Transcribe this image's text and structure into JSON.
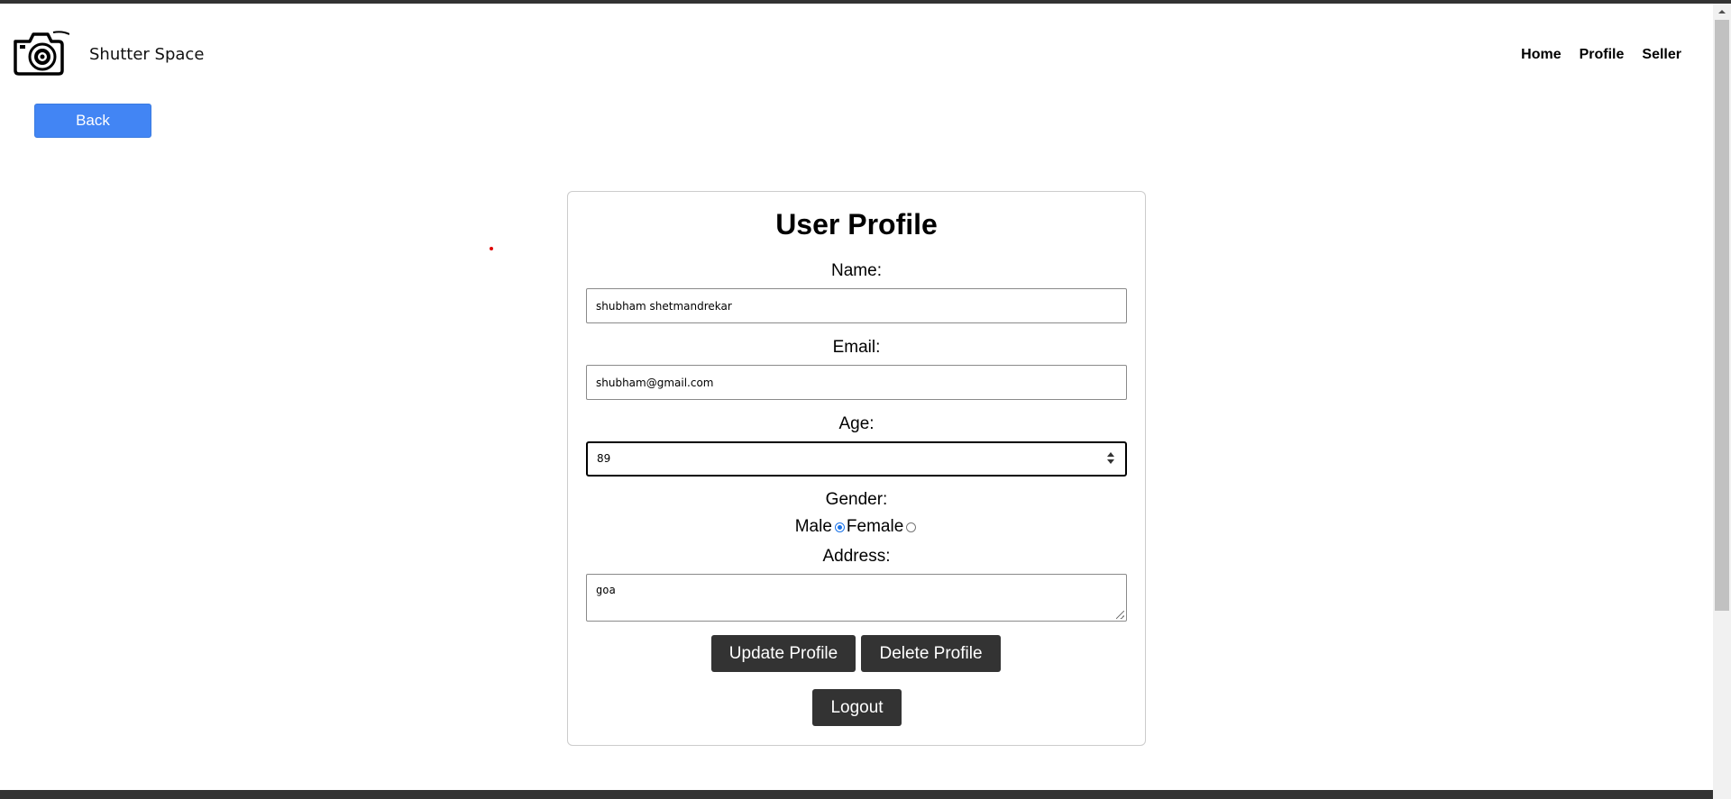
{
  "header": {
    "brand": "Shutter Space",
    "nav": [
      "Home",
      "Profile",
      "Seller"
    ]
  },
  "back_label": "Back",
  "profile": {
    "title": "User Profile",
    "name_label": "Name:",
    "name_value": "shubham shetmandrekar",
    "email_label": "Email:",
    "email_value": "shubham@gmail.com",
    "age_label": "Age:",
    "age_value": "89",
    "gender_label": "Gender:",
    "gender_options": [
      "Male",
      "Female"
    ],
    "gender_selected": "Male",
    "address_label": "Address:",
    "address_value": "goa",
    "update_label": "Update Profile",
    "delete_label": "Delete Profile",
    "logout_label": "Logout"
  },
  "colors": {
    "accent": "#4285f4",
    "dark_button": "#333333",
    "frame": "#333333"
  },
  "icons": {
    "logo": "camera-icon"
  }
}
